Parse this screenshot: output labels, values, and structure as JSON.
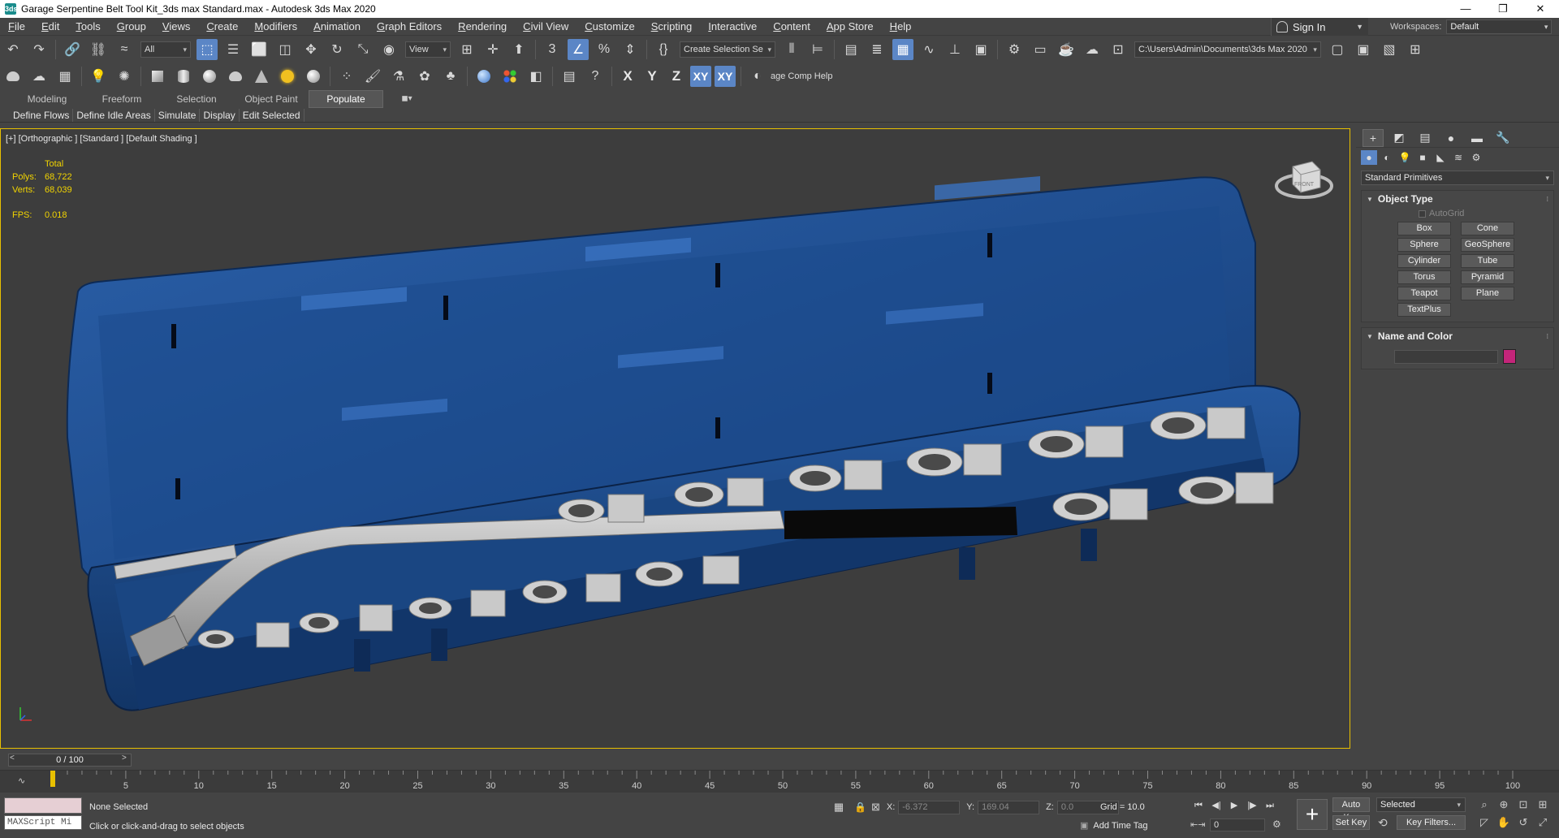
{
  "window": {
    "title": "Garage Serpentine Belt Tool Kit_3ds max Standard.max - Autodesk 3ds Max 2020",
    "app_icon": "3ds",
    "controls": [
      "—",
      "❐",
      "✕"
    ]
  },
  "menu": {
    "items": [
      "File",
      "Edit",
      "Tools",
      "Group",
      "Views",
      "Create",
      "Modifiers",
      "Animation",
      "Graph Editors",
      "Rendering",
      "Civil View",
      "Customize",
      "Scripting",
      "Interactive",
      "Content",
      "App Store",
      "Help"
    ],
    "sign_in": "Sign In",
    "workspaces_label": "Workspaces:",
    "workspaces_value": "Default"
  },
  "toolbar": {
    "selection_filter": "All",
    "reference_coord": "View",
    "named_selection": "Create Selection Se",
    "project_path": "C:\\Users\\Admin\\Documents\\3ds Max 2020",
    "axis_x": "X",
    "axis_y": "Y",
    "axis_z": "Z",
    "axis_xy": "XY",
    "axis_xy2": "XY",
    "image_comp": "age Comp Help"
  },
  "ribbon": {
    "tabs": [
      "Modeling",
      "Freeform",
      "Selection",
      "Object Paint",
      "Populate"
    ],
    "active_tab": "Populate",
    "sub_items": [
      "Define Flows",
      "Define Idle Areas",
      "Simulate",
      "Display",
      "Edit Selected"
    ]
  },
  "viewport": {
    "label": "[+] [Orthographic ] [Standard ] [Default Shading ]",
    "stats_header": "Total",
    "polys_label": "Polys:",
    "polys_value": "68,722",
    "verts_label": "Verts:",
    "verts_value": "68,039",
    "fps_label": "FPS:",
    "fps_value": "0.018",
    "viewcube_label": "FRONT"
  },
  "command_panel": {
    "category": "Standard Primitives",
    "object_type_title": "Object Type",
    "autogrid_label": "AutoGrid",
    "primitives": [
      "Box",
      "Cone",
      "Sphere",
      "GeoSphere",
      "Cylinder",
      "Tube",
      "Torus",
      "Pyramid",
      "Teapot",
      "Plane",
      "TextPlus"
    ],
    "name_color_title": "Name and Color",
    "swatch_color": "#c4257a"
  },
  "timeline": {
    "frame_display": "0 / 100",
    "ticks": [
      5,
      10,
      15,
      20,
      25,
      30,
      35,
      40,
      45,
      50,
      55,
      60,
      65,
      70,
      75,
      80,
      85,
      90,
      95,
      100
    ]
  },
  "status": {
    "maxscript_placeholder": "MAXScript Mi",
    "selection": "None Selected",
    "prompt": "Click or click-and-drag to select objects",
    "x_label": "X:",
    "x_value": "-6.372",
    "y_label": "Y:",
    "y_value": "169.04",
    "z_label": "Z:",
    "z_value": "0.0",
    "grid": "Grid = 10.0",
    "add_time_tag": "Add Time Tag",
    "current_frame": "0",
    "auto_key": "Auto Key",
    "set_key": "Set Key",
    "key_target": "Selected",
    "key_filters": "Key Filters..."
  },
  "colors": {
    "case_blue": "#1e4d8c",
    "highlight_blue": "#5b86c6",
    "stats_yellow": "#f2d400",
    "viewport_border": "#e8c000"
  }
}
